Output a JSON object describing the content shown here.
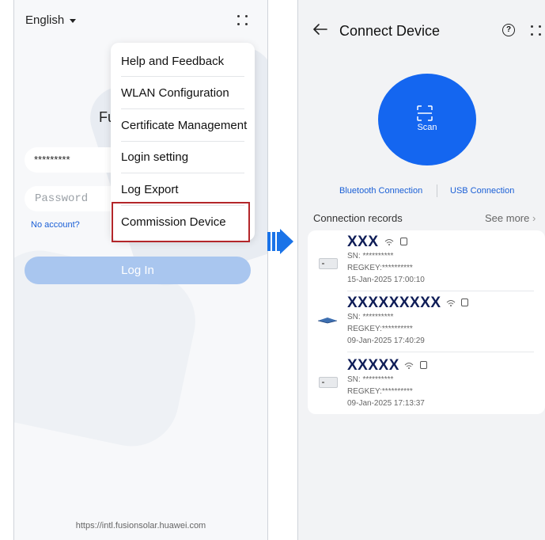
{
  "left_screen": {
    "language": "English",
    "password_masked": "*********",
    "password_placeholder": "Password",
    "title_partial": "Fu",
    "no_account": "No account?",
    "login_button": "Log In",
    "footer_url": "https://intl.fusionsolar.huawei.com",
    "menu": {
      "items": [
        {
          "label": "Help and Feedback"
        },
        {
          "label": "WLAN Configuration"
        },
        {
          "label": "Certificate Management"
        },
        {
          "label": "Login setting"
        },
        {
          "label": "Log Export"
        },
        {
          "label": "Commission Device"
        }
      ],
      "highlighted_item": "Commission Device"
    }
  },
  "right_screen": {
    "title": "Connect Device",
    "help_icon": "?",
    "scan_label": "Scan",
    "bluetooth_link": "Bluetooth Connection",
    "usb_link": "USB Connection",
    "records_title": "Connection records",
    "see_more": "See more",
    "records": [
      {
        "name": "XXX",
        "sn": "SN: **********",
        "regkey": "REGKEY:**********",
        "time": "15-Jan-2025 17:00:10",
        "icon": "inverter-icon"
      },
      {
        "name": "XXXXXXXXX",
        "sn": "SN: **********",
        "regkey": "REGKEY:**********",
        "time": "09-Jan-2025 17:40:29",
        "icon": "smart-dongle-icon"
      },
      {
        "name": "XXXXX",
        "sn": "SN: **********",
        "regkey": "REGKEY:**********",
        "time": "09-Jan-2025 17:13:37",
        "icon": "inverter-icon"
      }
    ]
  },
  "colors": {
    "accent_blue": "#1466f0",
    "link_blue": "#1a5fd6",
    "highlight_red": "#b3262a",
    "login_button_disabled": "#a9c6ef",
    "record_name": "#0f1d57"
  }
}
